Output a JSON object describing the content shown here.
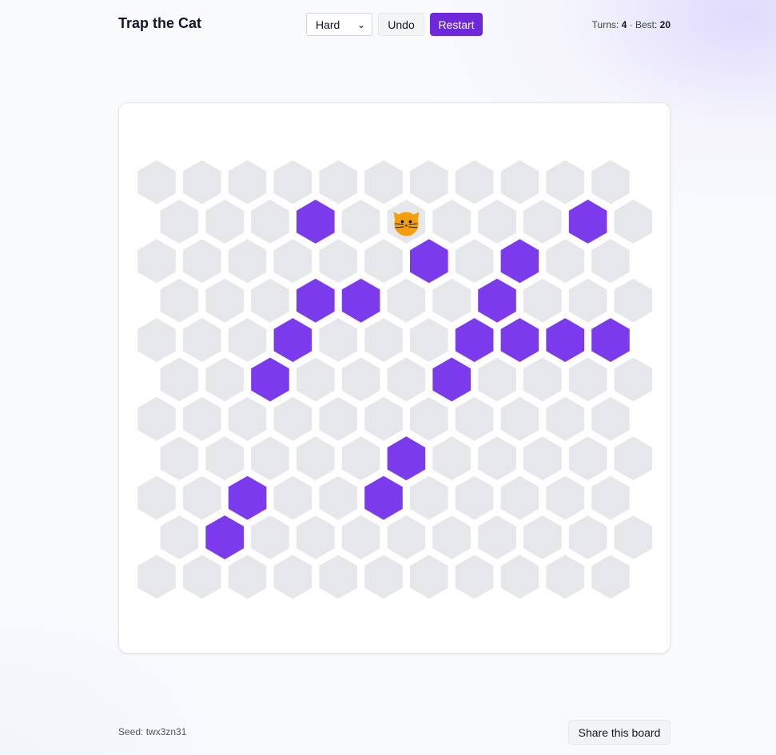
{
  "header": {
    "title": "Trap the Cat",
    "difficulty_selected": "Hard",
    "undo_label": "Undo",
    "restart_label": "Restart",
    "turns_label": "Turns:",
    "turns_value": "4",
    "separator": "·",
    "best_label": "Best:",
    "best_value": "20"
  },
  "board": {
    "rows": 11,
    "cols": 11,
    "blocked": [
      [
        1,
        3
      ],
      [
        1,
        9
      ],
      [
        2,
        6
      ],
      [
        2,
        8
      ],
      [
        3,
        3
      ],
      [
        3,
        4
      ],
      [
        3,
        7
      ],
      [
        4,
        3
      ],
      [
        4,
        7
      ],
      [
        4,
        8
      ],
      [
        4,
        9
      ],
      [
        4,
        10
      ],
      [
        5,
        2
      ],
      [
        5,
        6
      ],
      [
        7,
        5
      ],
      [
        8,
        2
      ],
      [
        8,
        5
      ],
      [
        9,
        1
      ]
    ],
    "cat": [
      1,
      5
    ],
    "colors": {
      "empty": "#e5e7eb",
      "blocked": "#7c3aed",
      "cat": "#f59e0b"
    }
  },
  "footer": {
    "seed_label": "Seed: twx3zn31",
    "share_label": "Share this board"
  },
  "colors": {
    "accent": "#6d28d9"
  }
}
